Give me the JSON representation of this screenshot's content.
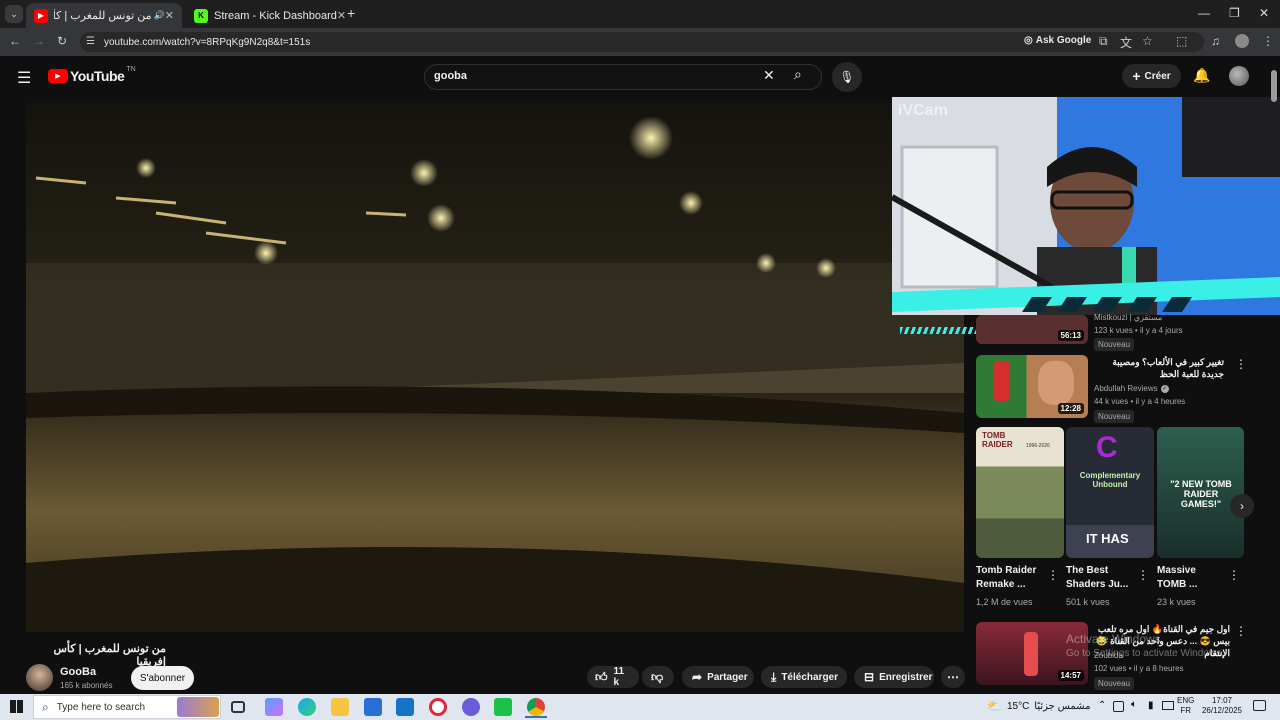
{
  "browser": {
    "tabs": [
      {
        "title": "من تونس للمغرب | كأس إفريقي",
        "active": true
      },
      {
        "title": "Stream - Kick Dashboard",
        "active": false
      }
    ],
    "url": "youtube.com/watch?v=8RPqKg9N2q8&t=151s",
    "ask_google": "Ask Google"
  },
  "youtube": {
    "logo_text": "YouTube",
    "logo_region": "TN",
    "search_value": "gooba",
    "create_label": "Créer"
  },
  "overlay": {
    "watermark": "iVCam"
  },
  "video": {
    "title": "من تونس للمغرب | كأس إفريقيا",
    "channel": "GooBa",
    "subscribers": "165 k abonnés",
    "subscribe_label": "S'abonner",
    "likes": "11 k",
    "share_label": "Partager",
    "download_label": "Télécharger",
    "save_label": "Enregistrer"
  },
  "sidebar": {
    "item_partial": {
      "channel": "Mistkouzi | مستقزي",
      "meta": "123 k vues • il y a 4 jours",
      "badge": "Nouveau",
      "duration": "56:13"
    },
    "item_2": {
      "title": "تغيير كبير في الألعاب؟ ومصيبة جديدة للعبة الحظ",
      "channel": "Abdullah Reviews",
      "meta": "44 k vues • il y a 4 heures",
      "badge": "Nouveau",
      "duration": "12:28"
    },
    "shelf": [
      {
        "title": "Tomb Raider Remake ...",
        "views": "1,2 M de vues",
        "thumb_text_top": "TOMB RAIDER",
        "thumb_text_sub": "1996-2026"
      },
      {
        "title": "The Best Shaders Ju...",
        "views": "501 k vues",
        "thumb_text_top": "Complementary Unbound",
        "thumb_text_sub": "IT HAS"
      },
      {
        "title": "Massive TOMB ...",
        "views": "23 k vues",
        "thumb_text_top": "\"2 NEW TOMB RAIDER GAMES!\"",
        "thumb_text_sub": ""
      }
    ],
    "item_3": {
      "title": "اول جيم في القناة🔥 اول مره تلعب بيس 😎 ... دعس واحد من القناة 😂 الإنتقام",
      "channel": "Zoubida",
      "meta": "102 vues • il y a 8 heures",
      "badge": "Nouveau",
      "duration": "14:57"
    }
  },
  "windows_watermark": {
    "line1": "Activate Windows",
    "line2": "Go to Settings to activate Windows."
  },
  "taskbar": {
    "search_placeholder": "Type here to search",
    "weather": "15°C",
    "weather_desc": "مشمس جزئيًا",
    "lang_top": "ENG",
    "lang_bottom": "FR",
    "time": "17:07",
    "date": "26/12/2025"
  }
}
